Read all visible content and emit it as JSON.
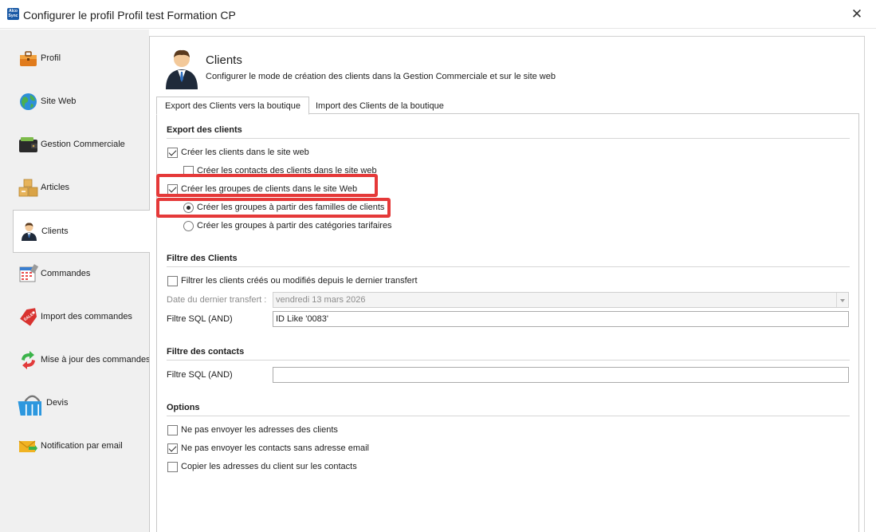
{
  "window": {
    "title": "Configurer le profil Profil test Formation CP",
    "app_icon_text": "Alco Sync",
    "close_glyph": "✕"
  },
  "sidebar": {
    "items": [
      {
        "label": "Profil",
        "icon": "briefcase-icon",
        "active": false
      },
      {
        "label": "Site Web",
        "icon": "globe-icon",
        "active": false
      },
      {
        "label": "Gestion Commerciale",
        "icon": "wallet-icon",
        "active": false
      },
      {
        "label": "Articles",
        "icon": "boxes-icon",
        "active": false
      },
      {
        "label": "Clients",
        "icon": "user-icon",
        "active": true
      },
      {
        "label": "Commandes",
        "icon": "calendar-icon",
        "active": false
      },
      {
        "label": "Import des commandes",
        "icon": "sale-tag-icon",
        "active": false
      },
      {
        "label": "Mise à jour des commandes",
        "icon": "sync-arrows-icon",
        "active": false
      },
      {
        "label": "Devis",
        "icon": "basket-icon",
        "active": false
      },
      {
        "label": "Notification par email",
        "icon": "envelope-icon",
        "active": false
      }
    ]
  },
  "header": {
    "title": "Clients",
    "description": "Configurer le mode de création des clients dans la Gestion Commerciale et sur le site web"
  },
  "tabs": [
    {
      "label": "Export des Clients vers la boutique",
      "active": true
    },
    {
      "label": "Import des Clients de la boutique",
      "active": false
    }
  ],
  "export_section": {
    "title": "Export des clients",
    "create_clients": {
      "label": "Créer les clients dans le site web",
      "checked": true
    },
    "create_contacts": {
      "label": "Créer les contacts des clients dans le site web",
      "checked": false
    },
    "create_groups": {
      "label": "Créer les groupes de clients dans le site Web",
      "checked": true
    },
    "groups_from_families": {
      "label": "Créer les groupes à partir des familles de clients",
      "selected": true
    },
    "groups_from_categories": {
      "label": "Créer les groupes à partir des catégories tarifaires",
      "selected": false
    }
  },
  "filter_clients_section": {
    "title": "Filtre des Clients",
    "filter_modified": {
      "label": "Filtrer les clients créés ou modifiés depuis le dernier transfert",
      "checked": false
    },
    "last_transfer_label": "Date du dernier transfert :",
    "last_transfer_value": "vendredi 13 mars 2026",
    "sql_label": "Filtre SQL (AND)",
    "sql_value": "ID Like '0083'"
  },
  "filter_contacts_section": {
    "title": "Filtre des contacts",
    "sql_label": "Filtre SQL (AND)",
    "sql_value": ""
  },
  "options_section": {
    "title": "Options",
    "no_addresses": {
      "label": "Ne pas envoyer les adresses des clients",
      "checked": false
    },
    "no_contacts_without_email": {
      "label": "Ne pas envoyer les contacts sans adresse email",
      "checked": true
    },
    "copy_addresses": {
      "label": "Copier les adresses du client sur les contacts",
      "checked": false
    }
  },
  "colors": {
    "highlight": "#e53939",
    "sidebar_bg": "#f0f0f0",
    "border": "#c8c8c8"
  }
}
